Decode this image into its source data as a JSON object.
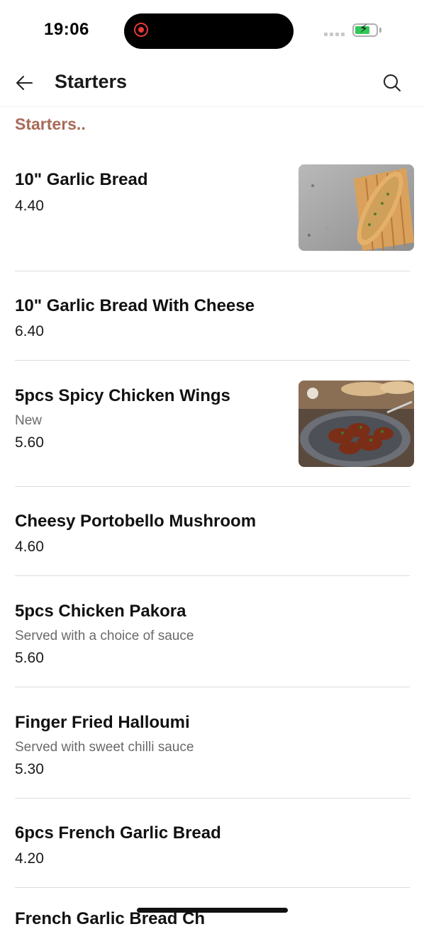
{
  "status_bar": {
    "time": "19:06"
  },
  "header": {
    "title": "Starters",
    "back_icon": "arrow-left-icon",
    "search_icon": "search-icon"
  },
  "section": {
    "title": "Starters.."
  },
  "items": [
    {
      "name": "10\" Garlic Bread",
      "desc": "",
      "price": "4.40",
      "image": "garlic-bread-photo"
    },
    {
      "name": "10\" Garlic Bread With Cheese",
      "desc": "",
      "price": "6.40"
    },
    {
      "name": "5pcs Spicy Chicken Wings",
      "desc": "New",
      "price": "5.60",
      "image": "chicken-wings-photo"
    },
    {
      "name": "Cheesy Portobello Mushroom",
      "desc": "",
      "price": "4.60"
    },
    {
      "name": "5pcs Chicken Pakora",
      "desc": "Served with a choice of sauce",
      "price": "5.60"
    },
    {
      "name": "Finger Fried Halloumi",
      "desc": "Served with sweet chilli sauce",
      "price": "5.30"
    },
    {
      "name": "6pcs French Garlic Bread",
      "desc": "",
      "price": "4.20"
    }
  ],
  "partial_item_name": "French Garlic Bread Ch",
  "colors": {
    "accent": "#a86a57",
    "divider": "#dcdcdc",
    "text": "#111111",
    "muted": "#6a6a6a"
  }
}
